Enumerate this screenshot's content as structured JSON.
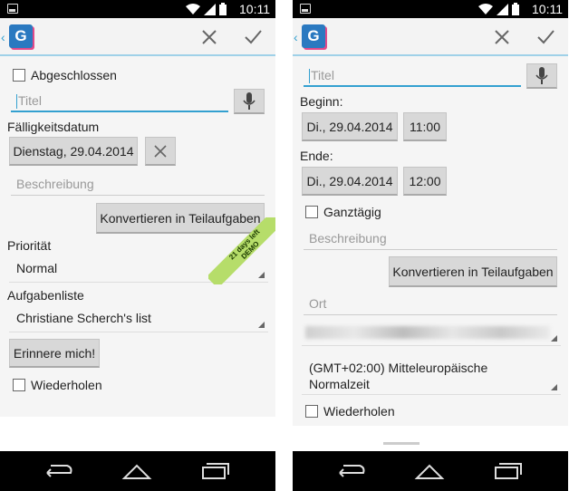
{
  "status": {
    "time": "10:11"
  },
  "left": {
    "completed_label": "Abgeschlossen",
    "title_placeholder": "Titel",
    "due_label": "Fälligkeitsdatum",
    "due_date": "Dienstag, 29.04.2014",
    "description_placeholder": "Beschreibung",
    "convert_button": "Konvertieren in Teilaufgaben",
    "priority_label": "Priorität",
    "priority_value": "Normal",
    "demo_badge_line1": "21 days left",
    "demo_badge_line2": "DEMO",
    "tasklist_label": "Aufgabenliste",
    "tasklist_value": "Christiane Scherch's list",
    "remind_button": "Erinnere mich!",
    "repeat_label": "Wiederholen"
  },
  "right": {
    "title_placeholder": "Titel",
    "begin_label": "Beginn:",
    "begin_date": "Di., 29.04.2014",
    "begin_time": "11:00",
    "end_label": "Ende:",
    "end_date": "Di., 29.04.2014",
    "end_time": "12:00",
    "allday_label": "Ganztägig",
    "description_placeholder": "Beschreibung",
    "convert_button": "Konvertieren in Teilaufgaben",
    "location_placeholder": "Ort",
    "timezone_line1": "(GMT+02:00) Mitteleuropäische",
    "timezone_line2": "Normalzeit",
    "repeat_label": "Wiederholen"
  },
  "icons": {
    "notification": "notification-icon",
    "wifi": "wifi-icon",
    "signal": "signal-icon",
    "battery": "battery-icon",
    "app": "app-logo-icon",
    "cancel": "close-icon",
    "confirm": "check-icon",
    "mic": "microphone-icon",
    "clear": "clear-date-icon",
    "back": "back-icon",
    "home": "home-icon",
    "recents": "recents-icon"
  },
  "colors": {
    "accent": "#33a0d0",
    "demo": "#b6dd6a",
    "button": "#d8d8d8"
  }
}
